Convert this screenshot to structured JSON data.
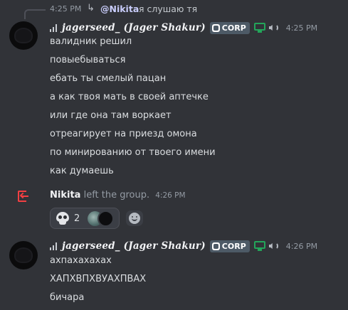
{
  "reply_preview": {
    "time": "4:25 PM",
    "mention": "@Nikita",
    "text": "я слушаю тя"
  },
  "message_groups": [
    {
      "username": "jagerseed_ (Jager Shakur)",
      "badge": "CORP",
      "time": "4:25 PM",
      "lines": [
        "валидник решил",
        "повыебываться",
        "ебать ты смелый пацан",
        "а как твоя мать в своей аптечке",
        "или где она там воркает",
        "отреагирует на приезд омона",
        "по минированию от твоего имени",
        "как думаешь"
      ]
    },
    {
      "username": "jagerseed_ (Jager Shakur)",
      "badge": "CORP",
      "time": "4:26 PM",
      "lines": [
        "ахпахахахах",
        "ХАПХВПХВУАХПВАХ",
        "бичара"
      ]
    }
  ],
  "system_message": {
    "name": "Nikita",
    "text": "left the group.",
    "time": "4:26 PM",
    "icon": "leave-arrow-icon",
    "color": "#f23f42"
  },
  "reaction": {
    "emoji": "skull-icon",
    "count": "2"
  },
  "colors": {
    "background": "#313338",
    "online": "#23a55a",
    "badge": "#4d5a66"
  }
}
